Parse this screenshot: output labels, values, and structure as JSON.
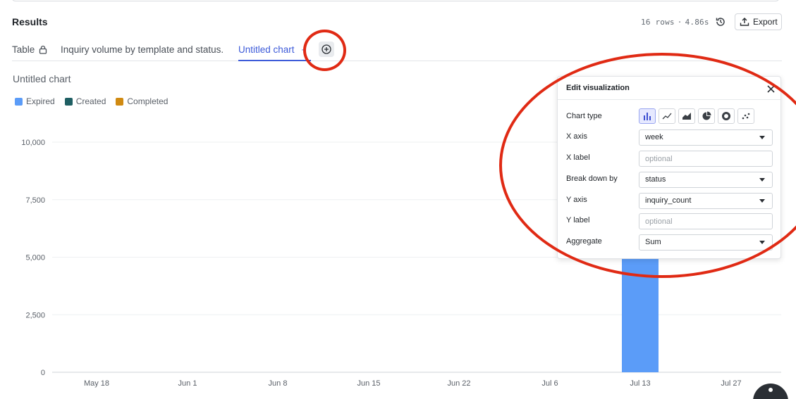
{
  "results": {
    "title": "Results",
    "rows": "16 rows",
    "separator": "·",
    "duration": "4.86s",
    "export_label": "Export"
  },
  "tabs": [
    {
      "label": "Table"
    },
    {
      "label": "Inquiry volume by template and status."
    },
    {
      "label": "Untitled chart",
      "dots": "··"
    }
  ],
  "chart_title": "Untitled chart",
  "legend": [
    {
      "label": "Expired",
      "color": "#5b9cf8"
    },
    {
      "label": "Created",
      "color": "#1f5f63"
    },
    {
      "label": "Completed",
      "color": "#d08a12"
    }
  ],
  "chart_data": {
    "type": "bar",
    "categories": [
      "May 18",
      "Jun 1",
      "Jun 8",
      "Jun 15",
      "Jun 22",
      "Jul 6",
      "Jul 13",
      "Jul 27"
    ],
    "y_ticks": [
      "10,000",
      "7,500",
      "5,000",
      "2,500",
      "0"
    ],
    "ylim": [
      0,
      10000
    ],
    "series": [
      {
        "name": "Expired",
        "color": "#5b9cf8",
        "values": [
          0,
          0,
          0,
          0,
          0,
          0,
          9900,
          0
        ]
      }
    ],
    "grid": true,
    "legend_position": "top-left"
  },
  "panel": {
    "title": "Edit visualization",
    "chart_type_label": "Chart type",
    "chart_types": [
      "bar-chart-icon",
      "line-chart-icon",
      "area-chart-icon",
      "pie-chart-icon",
      "donut-chart-icon",
      "scatter-chart-icon"
    ],
    "x_axis_label": "X axis",
    "x_axis_value": "week",
    "x_label_label": "X label",
    "x_label_placeholder": "optional",
    "breakdown_label": "Break down by",
    "breakdown_value": "status",
    "y_axis_label": "Y axis",
    "y_axis_value": "inquiry_count",
    "y_label_label": "Y label",
    "y_label_placeholder": "optional",
    "aggregate_label": "Aggregate",
    "aggregate_value": "Sum"
  },
  "colors": {
    "accent": "#3d5bd9",
    "annotation": "#e02a14"
  }
}
